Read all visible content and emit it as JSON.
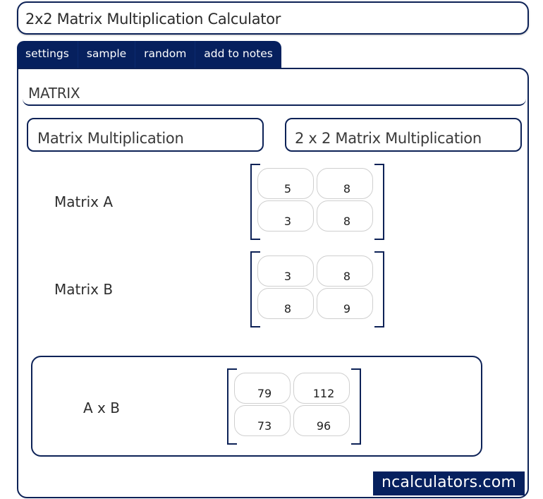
{
  "header": {
    "title": "2x2 Matrix Multiplication Calculator"
  },
  "tabs": [
    {
      "label": "settings"
    },
    {
      "label": "sample"
    },
    {
      "label": "random"
    },
    {
      "label": "add to notes"
    }
  ],
  "section": {
    "title": "MATRIX"
  },
  "category": {
    "left": "Matrix Multiplication",
    "right": "2 x 2 Matrix Multiplication"
  },
  "matrix_a": {
    "label": "Matrix A",
    "cells": [
      "5",
      "8",
      "3",
      "8"
    ]
  },
  "matrix_b": {
    "label": "Matrix B",
    "cells": [
      "3",
      "8",
      "8",
      "9"
    ]
  },
  "result": {
    "label": "A x B",
    "cells": [
      "79",
      "112",
      "73",
      "96"
    ]
  },
  "brand": {
    "text": "ncalculators.com"
  },
  "colors": {
    "primary": "#06205e",
    "border": "#0d2257"
  }
}
